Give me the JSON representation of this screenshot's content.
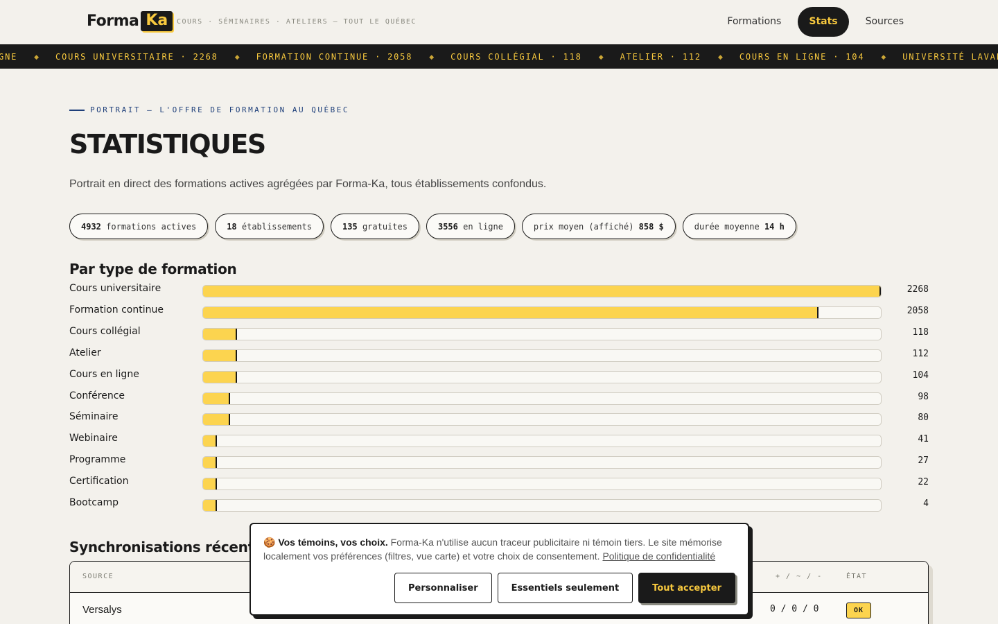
{
  "header": {
    "logo_forma": "Forma",
    "logo_ka": "Ka",
    "tagline": "COURS · SÉMINAIRES · ATELIERS — TOUT LE QUÉBEC",
    "nav": [
      {
        "label": "Formations",
        "active": false
      },
      {
        "label": "Stats",
        "active": true
      },
      {
        "label": "Sources",
        "active": false
      }
    ]
  },
  "ticker": {
    "items": [
      "LIGNE",
      "COURS UNIVERSITAIRE · 2268",
      "FORMATION CONTINUE · 2058",
      "COURS COLLÉGIAL · 118",
      "ATELIER · 112",
      "COURS EN LIGNE · 104",
      "UNIVERSITÉ LAVAL — FORMATION À"
    ]
  },
  "intro": {
    "eyebrow": "PORTRAIT — L'OFFRE DE FORMATION AU QUÉBEC",
    "title": "STATISTIQUES",
    "lead": "Portrait en direct des formations actives agrégées par Forma-Ka, tous établissements confondus."
  },
  "pills": [
    {
      "value": "4932",
      "label": "formations actives",
      "value_first": true
    },
    {
      "value": "18",
      "label": "établissements",
      "value_first": true
    },
    {
      "value": "135",
      "label": "gratuites",
      "value_first": true
    },
    {
      "value": "3556",
      "label": "en ligne",
      "value_first": true
    },
    {
      "value": "858 $",
      "label": "prix moyen (affiché)",
      "value_first": false
    },
    {
      "value": "14 h",
      "label": "durée moyenne",
      "value_first": false
    }
  ],
  "by_type": {
    "title": "Par type de formation",
    "rows": [
      {
        "label": "Cours universitaire",
        "value": 2268,
        "fill": 1.0
      },
      {
        "label": "Formation continue",
        "value": 2058,
        "fill": 0.908
      },
      {
        "label": "Cours collégial",
        "value": 118,
        "fill": 0.05
      },
      {
        "label": "Atelier",
        "value": 112,
        "fill": 0.05
      },
      {
        "label": "Cours en ligne",
        "value": 104,
        "fill": 0.05
      },
      {
        "label": "Conférence",
        "value": 98,
        "fill": 0.04
      },
      {
        "label": "Séminaire",
        "value": 80,
        "fill": 0.04
      },
      {
        "label": "Webinaire",
        "value": 41,
        "fill": 0.02
      },
      {
        "label": "Programme",
        "value": 27,
        "fill": 0.02
      },
      {
        "label": "Certification",
        "value": 22,
        "fill": 0.02
      },
      {
        "label": "Bootcamp",
        "value": 4,
        "fill": 0.02
      }
    ]
  },
  "sync": {
    "title": "Synchronisations récentes",
    "headers": {
      "source": "SOURCE",
      "counts": "+ / ~ / -",
      "state": "ÉTAT"
    },
    "rows": [
      {
        "source": "Versalys",
        "counts": "0 / 0 / 0",
        "state": "OK"
      }
    ]
  },
  "cookie": {
    "emoji": "🍪",
    "heading": "Vos témoins, vos choix.",
    "body": "Forma-Ka n'utilise aucun traceur publicitaire ni témoin tiers. Le site mémorise localement vos préférences (filtres, vue carte) et votre choix de consentement.",
    "policy_link": "Politique de confidentialité",
    "buttons": {
      "customize": "Personnaliser",
      "essentials": "Essentiels seulement",
      "accept": "Tout accepter"
    }
  },
  "colors": {
    "accent": "#fcd44f",
    "ink": "#1a1a1a",
    "background": "#f3f1ec",
    "eyebrow": "#1e3f7a"
  }
}
